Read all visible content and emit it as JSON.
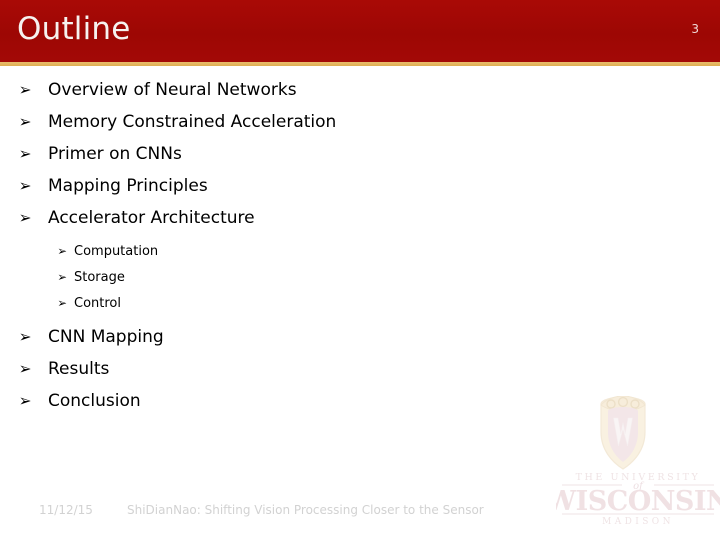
{
  "header": {
    "title": "Outline",
    "page_number": "3",
    "bar_color": "#a00806",
    "accent_color": "#e2b25a",
    "title_color": "#f6f2ef"
  },
  "content": {
    "bullet_glyph": "➢",
    "items": [
      {
        "level": 1,
        "label": "Overview of Neural Networks"
      },
      {
        "level": 1,
        "label": "Memory Constrained Acceleration"
      },
      {
        "level": 1,
        "label": "Primer on CNNs"
      },
      {
        "level": 1,
        "label": "Mapping Principles"
      },
      {
        "level": 1,
        "label": "Accelerator Architecture"
      },
      {
        "level": 2,
        "label": "Computation"
      },
      {
        "level": 2,
        "label": "Storage"
      },
      {
        "level": 2,
        "label": "Control"
      },
      {
        "level": 1,
        "label": "CNN Mapping"
      },
      {
        "level": 1,
        "label": "Results"
      },
      {
        "level": 1,
        "label": "Conclusion"
      }
    ]
  },
  "footer": {
    "date": "11/12/15",
    "title": "ShiDianNao: Shifting Vision Processing Closer to the Sensor",
    "text_color": "#d2d2d2"
  },
  "watermark": {
    "crest_letter": "W",
    "line1": "THE UNIVERSITY",
    "line2": "of",
    "line3": "WISCONSIN",
    "line4": "MADISON",
    "color": "#e8d3d6"
  }
}
